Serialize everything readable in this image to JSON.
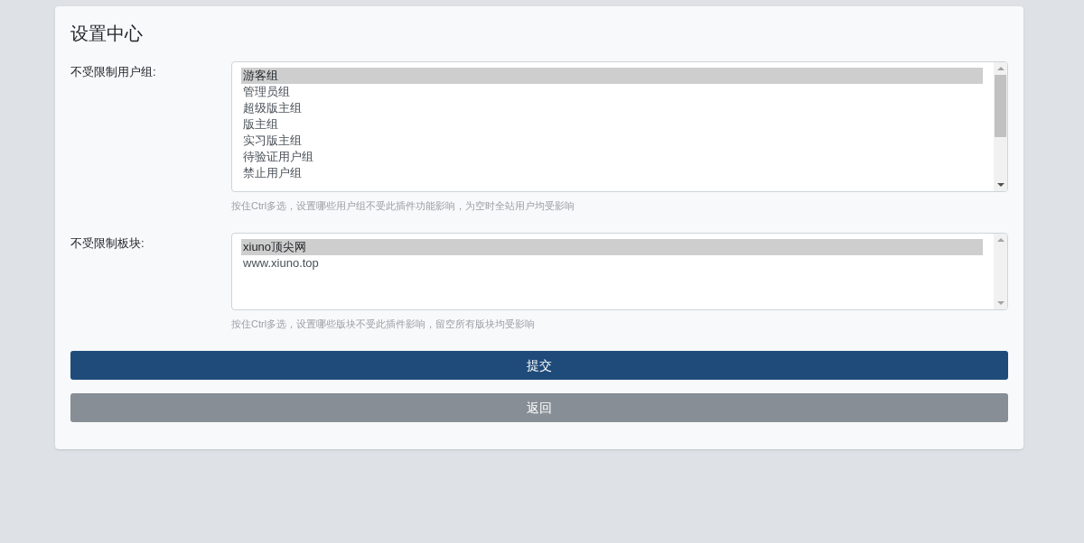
{
  "title": "设置中心",
  "fields": [
    {
      "label": "不受限制用户组:",
      "options": [
        {
          "text": "游客组",
          "selected": true
        },
        {
          "text": "管理员组",
          "selected": false
        },
        {
          "text": "超级版主组",
          "selected": false
        },
        {
          "text": "版主组",
          "selected": false
        },
        {
          "text": "实习版主组",
          "selected": false
        },
        {
          "text": "待验证用户组",
          "selected": false
        },
        {
          "text": "禁止用户组",
          "selected": false
        }
      ],
      "scrollable": true,
      "help": "按住Ctrl多选，设置哪些用户组不受此插件功能影响，为空时全站用户均受影响"
    },
    {
      "label": "不受限制板块:",
      "options": [
        {
          "text": "xiuno顶尖网",
          "selected": true
        },
        {
          "text": "www.xiuno.top",
          "selected": false
        }
      ],
      "scrollable": false,
      "help": "按住Ctrl多选，设置哪些版块不受此插件影响，留空所有版块均受影响"
    }
  ],
  "buttons": [
    {
      "label": "提交",
      "kind": "primary"
    },
    {
      "label": "返回",
      "kind": "secondary"
    }
  ]
}
